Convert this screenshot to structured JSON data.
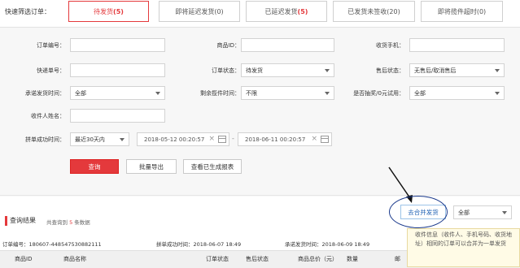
{
  "quick_filter": {
    "label": "快速筛选订单：",
    "tabs": [
      {
        "label": "待发货",
        "count": "(5)"
      },
      {
        "label": "即将延迟发货",
        "count": "(0)"
      },
      {
        "label": "已延迟发货",
        "count": "(5)"
      },
      {
        "label": "已发货未签收",
        "count": "(20)"
      },
      {
        "label": "即将揽件超时",
        "count": "(0)"
      }
    ]
  },
  "form": {
    "order_no": {
      "label": "订单编号：",
      "value": ""
    },
    "product_id": {
      "label": "商品ID：",
      "value": ""
    },
    "receiver_phone": {
      "label": "收货手机：",
      "value": ""
    },
    "tracking_no": {
      "label": "快递单号：",
      "value": ""
    },
    "order_status": {
      "label": "订单状态：",
      "value": "待发货"
    },
    "after_sale_status": {
      "label": "售后状态：",
      "value": "无售后/取消售后"
    },
    "promised_ship_time": {
      "label": "承诺发货时间：",
      "value": "全部"
    },
    "remaining_pickup_time": {
      "label": "剩余揽件时间：",
      "value": "不限"
    },
    "trial_0yuan": {
      "label": "是否抽奖/0元试用：",
      "value": "全部"
    },
    "receiver_name": {
      "label": "收件人姓名：",
      "value": ""
    },
    "group_success_time": {
      "label": "拼单成功时间：",
      "range": "最近30天内",
      "start": "2018-05-12 00:20:57",
      "dash": "-",
      "end": "2018-06-11 00:20:57"
    }
  },
  "buttons": {
    "search": "查询",
    "batch_export": "批量导出",
    "view_reports": "查看已生成报表"
  },
  "results": {
    "title": "查询结果",
    "summary_prefix": "共查询到",
    "count": "5",
    "summary_suffix": "条数据",
    "merge_button": "去合并发货",
    "merge_filter": "全部",
    "tooltip": "收件信息（收件人、手机号码、收货地址）相同的订单可以合并为一单发货",
    "order": {
      "no_label": "订单编号：",
      "no_value": "180607-448547530882111",
      "group_time_label": "拼单成功时间：",
      "group_time_value": "2018-06-07 18:49",
      "promise_label": "承诺发货时间：",
      "promise_value": "2018-06-09 18:49"
    },
    "columns": [
      "商品ID",
      "商品名称",
      "订单状态",
      "售后状态",
      "商品总价（元）",
      "数量",
      "邮"
    ]
  },
  "colors": {
    "accent": "#e4393c",
    "link": "#1c5fb3",
    "panel_bg": "#f7f7f7",
    "annotation_circle": "#1b3a8c"
  }
}
